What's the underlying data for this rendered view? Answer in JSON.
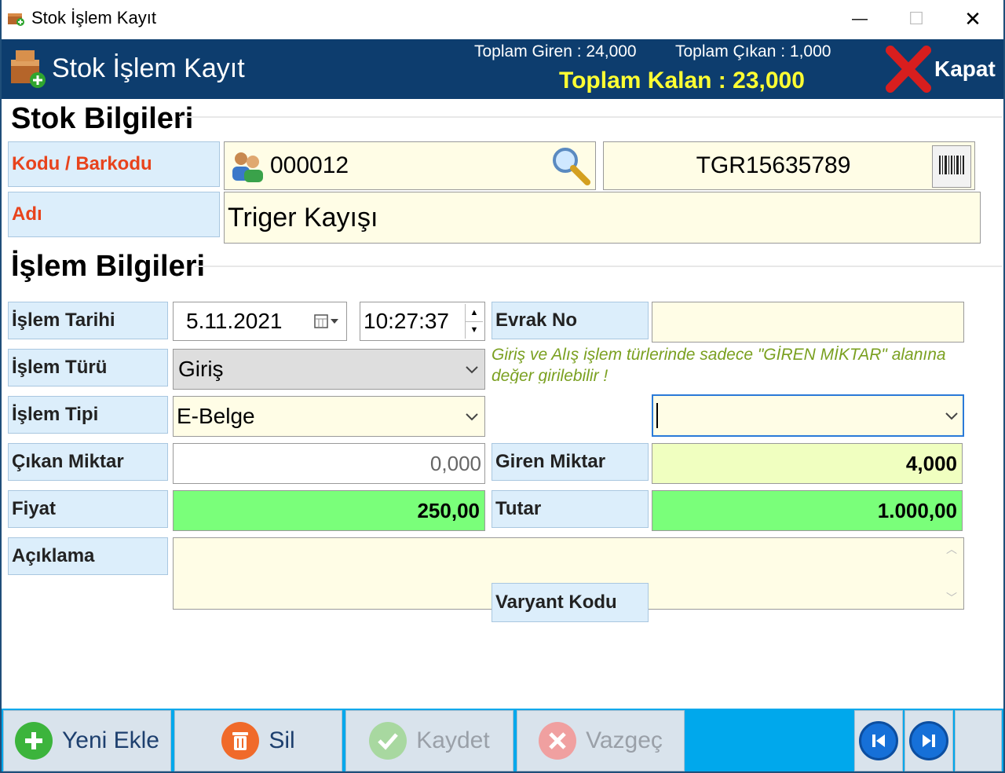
{
  "window": {
    "title": "Stok İşlem Kayıt",
    "minimize": "—",
    "maximize": "☐",
    "close": "✕"
  },
  "header": {
    "title": "Stok İşlem Kayıt",
    "toplam_giren": "Toplam Giren : 24,000",
    "toplam_cikan": "Toplam Çıkan : 1,000",
    "toplam_kalan": "Toplam Kalan : 23,000",
    "close_label": "Kapat"
  },
  "stok": {
    "section_title": "Stok Bilgileri",
    "kodu_label": "Kodu / Barkodu",
    "kodu_value": "000012",
    "barkod_value": "TGR15635789",
    "adi_label": "Adı",
    "adi_value": "Triger Kayışı"
  },
  "islem": {
    "section_title": "İşlem Bilgileri",
    "tarih_label": "İşlem Tarihi",
    "tarih_value": "5.11.2021",
    "saat_value": "10:27:37",
    "evrak_label": "Evrak No",
    "evrak_value": "",
    "tur_label": "İşlem Türü",
    "tur_value": "Giriş",
    "note": "Giriş ve Alış işlem türlerinde sadece \"GİREN MİKTAR\" alanına değer girilebilir !",
    "tip_label": "İşlem Tipi",
    "tip_value": "E-Belge",
    "extra_select_value": "",
    "cikan_label": "Çıkan Miktar",
    "cikan_value": "0,000",
    "giren_label": "Giren Miktar",
    "giren_value": "4,000",
    "fiyat_label": "Fiyat",
    "fiyat_value": "250,00",
    "tutar_label": "Tutar",
    "tutar_value": "1.000,00",
    "aciklama_label": "Açıklama",
    "aciklama_value": "",
    "varyant_label": "Varyant Kodu"
  },
  "toolbar": {
    "yeni_ekle": "Yeni Ekle",
    "sil": "Sil",
    "kaydet": "Kaydet",
    "vazgec": "Vazgeç"
  },
  "colors": {
    "header_bg": "#0d3d6e",
    "toolbar_bg": "#00a8ec",
    "label_bg": "#dceefb",
    "field_bg": "#fffde6",
    "accent_green": "#7aff7a"
  }
}
